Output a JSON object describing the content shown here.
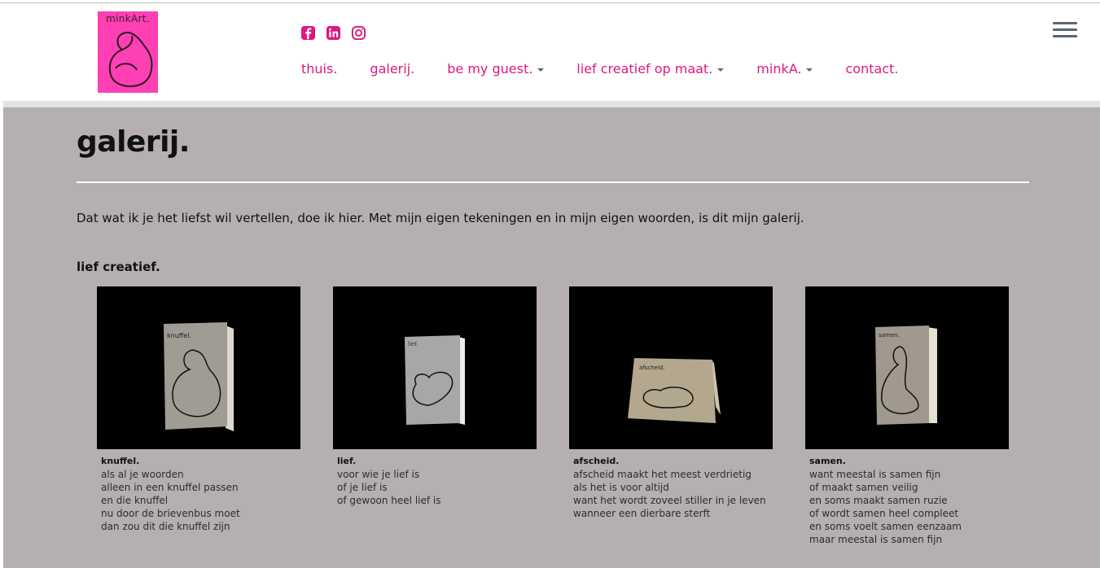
{
  "header": {
    "logo_text": "minkArt.",
    "social": [
      {
        "name": "facebook-icon"
      },
      {
        "name": "linkedin-icon"
      },
      {
        "name": "instagram-icon"
      }
    ],
    "nav": [
      {
        "label": "thuis.",
        "dropdown": false
      },
      {
        "label": "galerij.",
        "dropdown": false
      },
      {
        "label": "be my guest.",
        "dropdown": true
      },
      {
        "label": "lief creatief op maat.",
        "dropdown": true
      },
      {
        "label": "minkA.",
        "dropdown": true
      },
      {
        "label": "contact.",
        "dropdown": false
      }
    ]
  },
  "page": {
    "title": "galerij.",
    "intro": "Dat wat ik je het liefst wil vertellen, doe ik hier. Met mijn eigen tekeningen en in mijn eigen woorden, is dit mijn galerij.",
    "section_title": "lief creatief."
  },
  "cards": [
    {
      "title": "knuffel.",
      "card_label": "knuffel.",
      "lines": [
        "als al je woorden",
        "alleen in een knuffel passen",
        "en die knuffel",
        "nu door de brievenbus moet",
        "dan zou dit die knuffel zijn"
      ]
    },
    {
      "title": "lief.",
      "card_label": "lief.",
      "lines": [
        "voor wie je lief is",
        "of je lief is",
        "of gewoon heel lief is"
      ]
    },
    {
      "title": "afscheid.",
      "card_label": "afscheid.",
      "lines": [
        "afscheid maakt het meest verdrietig",
        "als het is voor altijd",
        "want het wordt zoveel stiller in je leven",
        "wanneer een dierbare sterft"
      ]
    },
    {
      "title": "samen.",
      "card_label": "samen.",
      "lines": [
        "want meestal is samen fijn",
        "of maakt samen veilig",
        "en soms maakt samen ruzie",
        "of wordt samen heel compleet",
        "en soms voelt samen eenzaam",
        "maar meestal is samen fijn"
      ]
    }
  ],
  "colors": {
    "accent": "#e0177d",
    "logo_bg": "#ff3fb4",
    "content_bg": "#b5afaf",
    "photo_bg": "#000000"
  }
}
